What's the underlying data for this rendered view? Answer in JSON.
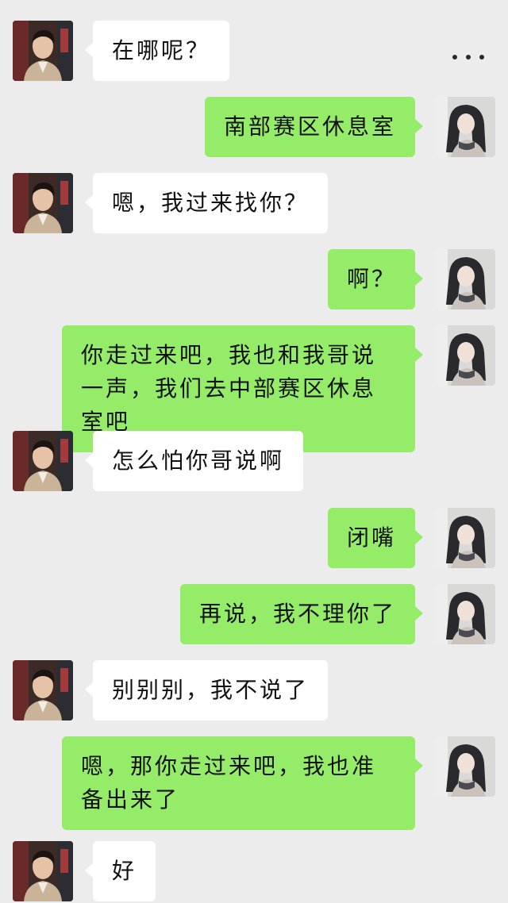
{
  "header": {
    "more_icon": "more-horizontal-icon"
  },
  "contacts": {
    "left_avatar": "avatar-young-man",
    "right_avatar": "avatar-young-woman"
  },
  "colors": {
    "background": "#ececec",
    "sent_bubble": "#95ec69",
    "received_bubble": "#ffffff"
  },
  "messages": [
    {
      "side": "left",
      "text": "在哪呢？"
    },
    {
      "side": "right",
      "text": "南部赛区休息室"
    },
    {
      "side": "left",
      "text": "嗯，我过来找你？"
    },
    {
      "side": "right",
      "text": "啊？"
    },
    {
      "side": "right",
      "text": "你走过来吧，我也和我哥说一声，我们去中部赛区休息室吧"
    },
    {
      "side": "left",
      "text": "怎么怕你哥说啊"
    },
    {
      "side": "right",
      "text": "闭嘴"
    },
    {
      "side": "right",
      "text": "再说，我不理你了"
    },
    {
      "side": "left",
      "text": "别别别，我不说了"
    },
    {
      "side": "right",
      "text": "嗯，那你走过来吧，我也准备出来了"
    },
    {
      "side": "left",
      "text": "好"
    }
  ]
}
